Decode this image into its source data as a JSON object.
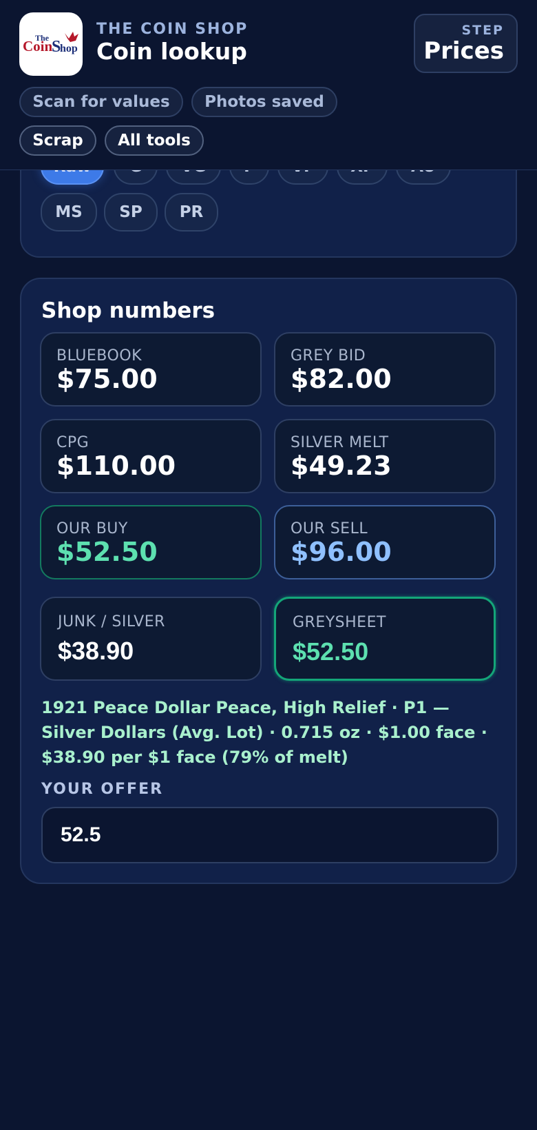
{
  "header": {
    "logo_alt": "The Coin Shop",
    "eyebrow": "THE COIN SHOP",
    "title": "Coin lookup",
    "step_label": "STEP",
    "step_value": "Prices"
  },
  "nav": {
    "items": [
      "Scan for values",
      "Photos saved",
      "Scrap",
      "All tools"
    ]
  },
  "grades": {
    "selected": "Raw",
    "row1": [
      "Raw",
      "G",
      "VG",
      "F",
      "VF",
      "XF",
      "AU"
    ],
    "row2": [
      "MS",
      "SP",
      "PR"
    ]
  },
  "shop": {
    "title": "Shop numbers",
    "stats": [
      {
        "label": "BLUEBOOK",
        "value": "$75.00"
      },
      {
        "label": "GREY BID",
        "value": "$82.00"
      },
      {
        "label": "CPG",
        "value": "$110.00"
      },
      {
        "label": "SILVER MELT",
        "value": "$49.23"
      },
      {
        "label": "OUR BUY",
        "value": "$52.50"
      },
      {
        "label": "OUR SELL",
        "value": "$96.00"
      }
    ],
    "junk": {
      "label": "JUNK / SILVER",
      "value": "$38.90"
    },
    "greysheet": {
      "label": "GREYSHEET",
      "value": "$52.50"
    },
    "description": "1921 Peace Dollar Peace, High Relief · P1 — Silver Dollars (Avg. Lot) · 0.715 oz · $1.00 face · $38.90 per $1 face (79% of melt)",
    "offer_label": "YOUR OFFER",
    "offer_value": "52.5"
  },
  "colors": {
    "background": "#0b1530",
    "card": "#112149",
    "accent_blue": "#3d7ae8",
    "buy_green": "#5de0b0",
    "sell_blue": "#8fc0ff"
  }
}
